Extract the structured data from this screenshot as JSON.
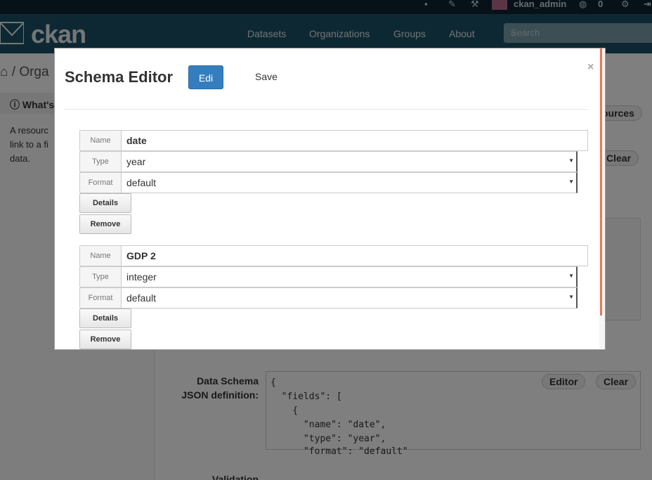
{
  "account": {
    "username": "ckan_admin",
    "notification_count": "0"
  },
  "masthead": {
    "logo_text": "ckan",
    "nav": [
      "Datasets",
      "Organizations",
      "Groups",
      "About"
    ],
    "search_placeholder": "Search"
  },
  "page": {
    "breadcrumb_sep": "/",
    "breadcrumb_item": "Orga",
    "sidebar_title": "What's",
    "sidebar_text": [
      "A resourc",
      "link to a fi",
      "data."
    ],
    "bg_buttons": {
      "resources": "ources",
      "clear_top": "Clear",
      "editor": "Editor",
      "clear": "Clear"
    },
    "schema_label": [
      "Data Schema",
      "JSON definition:"
    ],
    "validation_label": "Validation",
    "json_lines": [
      "{",
      "  \"fields\": [",
      "    {",
      "      \"name\": \"date\",",
      "      \"type\": \"year\",",
      "      \"format\": \"default\""
    ]
  },
  "modal": {
    "title": "Schema Editor",
    "edit_label": "Edi",
    "save_label": "Save",
    "close_label": "×",
    "labels": {
      "name": "Name",
      "type": "Type",
      "format": "Format",
      "details": "Details",
      "remove": "Remove"
    },
    "fields": [
      {
        "name": "date",
        "type": "year",
        "format": "default"
      },
      {
        "name": "GDP 2",
        "type": "integer",
        "format": "default"
      }
    ]
  },
  "colors": {
    "primary": "#357ebd",
    "masthead": "#1c5167",
    "account_bar": "#0c2430",
    "accent": "#e57b55"
  }
}
